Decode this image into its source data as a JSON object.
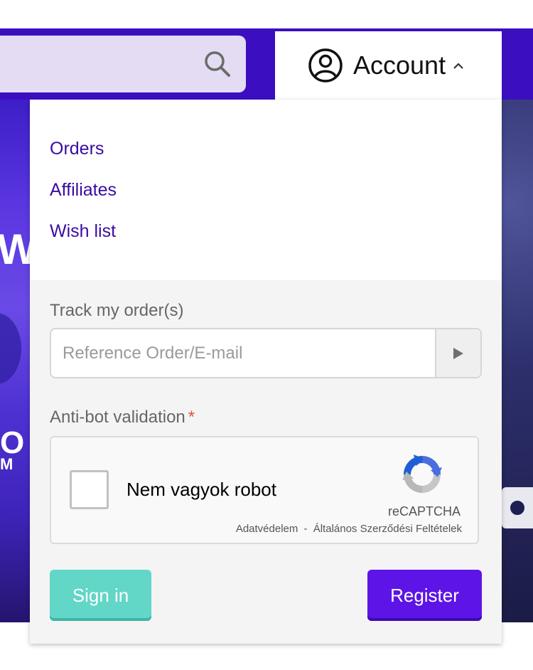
{
  "header": {
    "account_label": "Account"
  },
  "account_menu": {
    "items": [
      {
        "label": "Orders"
      },
      {
        "label": "Affiliates"
      },
      {
        "label": "Wish list"
      }
    ]
  },
  "track_order": {
    "label": "Track my order(s)",
    "placeholder": "Reference Order/E-mail",
    "value": ""
  },
  "antibot": {
    "label": "Anti-bot validation",
    "required_mark": "*",
    "captcha_text": "Nem vagyok robot",
    "brand": "reCAPTCHA",
    "privacy_link": "Adatvédelem",
    "separator": "-",
    "terms_link": "Általános Szerződési Feltételek"
  },
  "actions": {
    "signin_label": "Sign in",
    "register_label": "Register"
  },
  "banner": {
    "left_letters_1": "W",
    "left_letters_2": "O",
    "left_letters_3": "M"
  },
  "colors": {
    "header_bar": "#3b0fbf",
    "menu_link": "#3a0ca3",
    "signin_button": "#62d6c7",
    "register_button": "#5d14e6",
    "required_star": "#e0503a"
  },
  "icons": {
    "search": "search-icon",
    "account": "account-circle-icon",
    "chevron": "chevron-up-icon",
    "submit": "play-arrow-icon",
    "recaptcha": "recaptcha-logo-icon"
  }
}
